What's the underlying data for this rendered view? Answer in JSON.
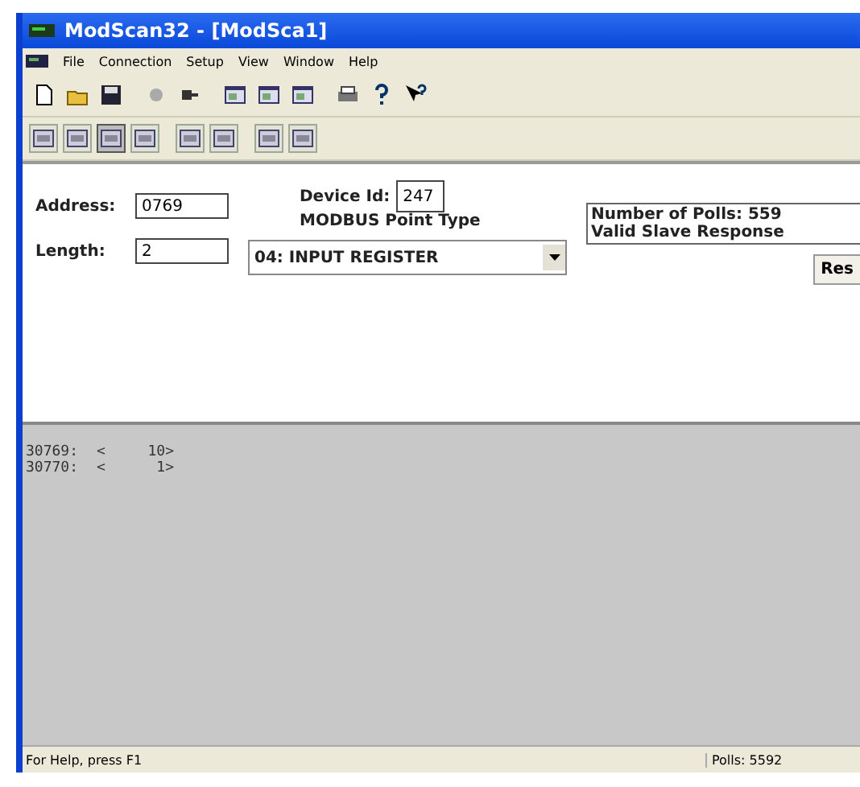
{
  "window": {
    "title": "ModScan32 - [ModSca1]"
  },
  "menu": [
    {
      "label": "File"
    },
    {
      "label": "Connection"
    },
    {
      "label": "Setup"
    },
    {
      "label": "View"
    },
    {
      "label": "Window"
    },
    {
      "label": "Help"
    }
  ],
  "toolbar_2": [
    {
      "selected": false
    },
    {
      "selected": false
    },
    {
      "selected": true
    },
    {
      "selected": false
    },
    {
      "selected": false
    },
    {
      "selected": false
    },
    {
      "selected": false
    },
    {
      "selected": false
    }
  ],
  "form": {
    "address_label": "Address:",
    "address": "0769",
    "length_label": "Length:",
    "length": "2",
    "device_id_label": "Device Id:",
    "device_id": "247",
    "point_type_label": "MODBUS Point Type",
    "point_type": "04: INPUT REGISTER",
    "polls": "Number of Polls: 559",
    "responses": "Valid Slave Response",
    "reset_button": "Res"
  },
  "data_rows": [
    {
      "address": "30769:",
      "open": "<",
      "value": "10>"
    },
    {
      "address": "30770:",
      "open": "<",
      "value": "1>"
    }
  ],
  "status_bar": {
    "help": "For Help, press F1",
    "polls": "Polls: 5592"
  }
}
